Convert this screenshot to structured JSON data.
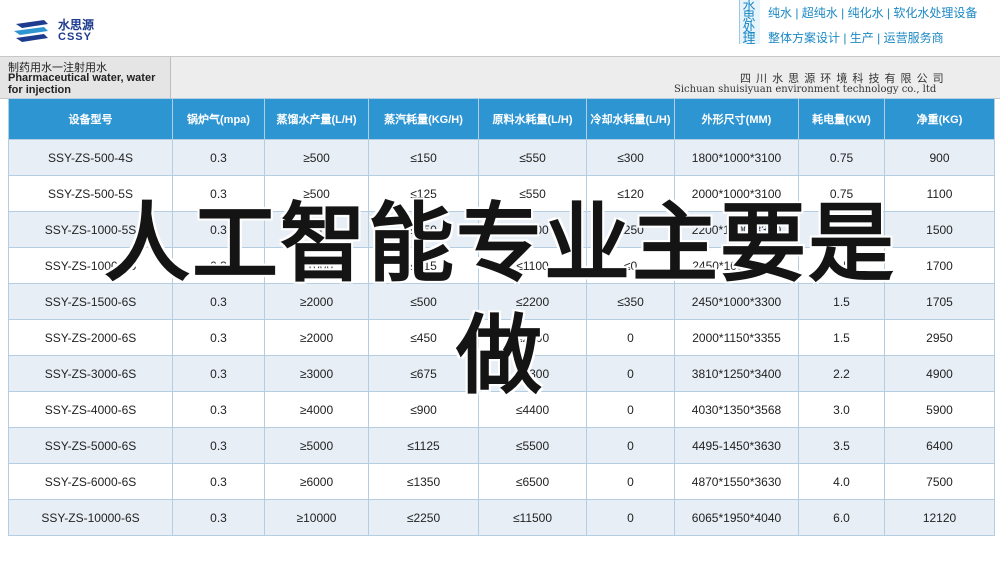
{
  "header": {
    "logo_cn": "水思源",
    "logo_en": "CSSY",
    "brand_vertical": "水思处理",
    "slogan_1": "纯水 | 超纯水 | 纯化水 | 软化水处理设备",
    "slogan_2": "整体方案设计 | 生产 | 运营服务商"
  },
  "title": {
    "cn": "制药用水一注射用水",
    "en": "Pharmaceutical water, water for injection",
    "company_cn": "四 川 水 思 源 环 境 科 技 有 限 公 司",
    "company_en": "Sichuan shuisiyuan environment technology co., ltd"
  },
  "table": {
    "columns": [
      "设备型号",
      "锅炉气(mpa)",
      "蒸馏水产量(L/H)",
      "蒸汽耗量(KG/H)",
      "原料水耗量(L/H)",
      "冷却水耗量(L/H)",
      "外形尺寸(MM)",
      "耗电量(KW)",
      "净重(KG)"
    ],
    "rows": [
      [
        "SSY-ZS-500-4S",
        "0.3",
        "≥500",
        "≤150",
        "≤550",
        "≤300",
        "1800*1000*3100",
        "0.75",
        "900"
      ],
      [
        "SSY-ZS-500-5S",
        "0.3",
        "≥500",
        "≤125",
        "≤550",
        "≤120",
        "2000*1000*3100",
        "0.75",
        "1100"
      ],
      [
        "SSY-ZS-1000-5S",
        "0.3",
        "≥1000",
        "≤250",
        "≤1100",
        "≤250",
        "2200*1000*3300",
        "1.5",
        "1500"
      ],
      [
        "SSY-ZS-1000-6S",
        "0.3",
        "≥1000",
        "≤215",
        "≤1100",
        "≤0",
        "2450*1000*3118",
        "1.5",
        "1700"
      ],
      [
        "SSY-ZS-1500-6S",
        "0.3",
        "≥2000",
        "≤500",
        "≤2200",
        "≤350",
        "2450*1000*3300",
        "1.5",
        "1705"
      ],
      [
        "SSY-ZS-2000-6S",
        "0.3",
        "≥2000",
        "≤450",
        "≤2200",
        "0",
        "2000*1150*3355",
        "1.5",
        "2950"
      ],
      [
        "SSY-ZS-3000-6S",
        "0.3",
        "≥3000",
        "≤675",
        "≤3300",
        "0",
        "3810*1250*3400",
        "2.2",
        "4900"
      ],
      [
        "SSY-ZS-4000-6S",
        "0.3",
        "≥4000",
        "≤900",
        "≤4400",
        "0",
        "4030*1350*3568",
        "3.0",
        "5900"
      ],
      [
        "SSY-ZS-5000-6S",
        "0.3",
        "≥5000",
        "≤1125",
        "≤5500",
        "0",
        "4495-1450*3630",
        "3.5",
        "6400"
      ],
      [
        "SSY-ZS-6000-6S",
        "0.3",
        "≥6000",
        "≤1350",
        "≤6500",
        "0",
        "4870*1550*3630",
        "4.0",
        "7500"
      ],
      [
        "SSY-ZS-10000-6S",
        "0.3",
        "≥10000",
        "≤2250",
        "≤11500",
        "0",
        "6065*1950*4040",
        "6.0",
        "12120"
      ]
    ]
  },
  "overlay": {
    "line1": "人工智能专业主要是",
    "line2": "做"
  },
  "colors": {
    "header_blue": "#2e95d3",
    "brand_text": "#1b88c4",
    "row_alt": "#e7eef5"
  }
}
